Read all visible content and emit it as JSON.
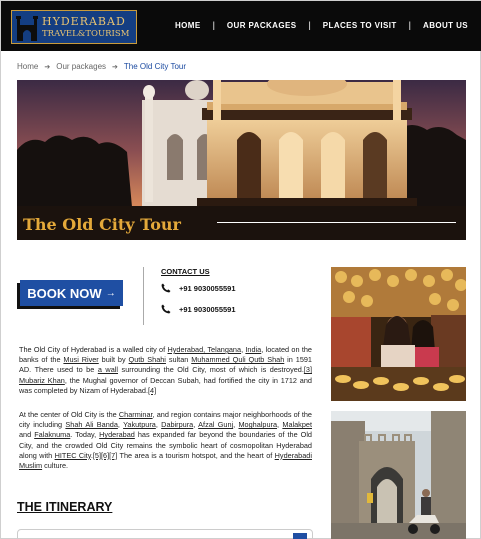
{
  "header": {
    "logo_line1": "HYDERABAD",
    "logo_line2": "TRAVEL&TOURISM",
    "nav": [
      "HOME",
      "OUR PACKAGES",
      "PLACES TO VISIT",
      "ABOUT US"
    ]
  },
  "breadcrumb": [
    "Home",
    "Our packages",
    "The Old City Tour"
  ],
  "hero": {
    "title": "The Old City Tour"
  },
  "booking": {
    "button_label": "BOOK NOW",
    "button_arrow": "→"
  },
  "contact": {
    "title": "CONTACT US",
    "phones": [
      "+91 9030055591",
      "+91 9030055591"
    ]
  },
  "paragraph1": {
    "t1": "The Old City of Hyderabad is a walled city of ",
    "l1": "Hyderabad, Telangana",
    "t2": ", ",
    "l2": "India",
    "t3": ", located on the banks of the ",
    "l3": "Musi River",
    "t4": " built by ",
    "l4": "Qutb Shahi",
    "t5": " sultan ",
    "l5": "Muhammed Quli Qutb Shah",
    "t6": " in 1591 AD. There used to be ",
    "l6": "a wall",
    "t7": " surrounding the Old City, most of which is destroyed.",
    "l7": "[3]",
    "t8": " ",
    "l8": "Mubariz Khan",
    "t9": ", the Mughal governor of Deccan Subah, had fortified the city in 1712 and was completed by Nizam of Hyderabad.",
    "l9": "[4]"
  },
  "paragraph2": {
    "t1": "At the center of Old City is the ",
    "l1": "Charminar",
    "t2": ", and region contains major neighborhoods of the city including ",
    "l2": "Shah Ali Banda",
    "t3": ", ",
    "l3": "Yakutpura",
    "t4": ", ",
    "l4": "Dabirpura",
    "t5": ", ",
    "l5": "Afzal Gunj",
    "t6": ", ",
    "l6": "Moghalpura",
    "t7": ", ",
    "l7": "Malakpet",
    "t8": " and ",
    "l8": "Falaknuma",
    "t9": ". Today, ",
    "l9": "Hyderabad",
    "t10": " has expanded far beyond the boundaries of the Old City, and the crowded Old City remains the symbolic heart of cosmopolitan Hyderabad along with ",
    "l10": "HITEC City",
    "t11": ".",
    "l11": "[5][6][7]",
    "t12": " The area is a tourism hotspot, and the heart of ",
    "l12": "Hyderabadi Muslim",
    "t13": " culture."
  },
  "itinerary": {
    "title": "THE ITINERARY"
  },
  "icons": {
    "logo": "charminar-logo-icon",
    "phone": "phone-icon",
    "breadcrumb_separator": "arrow-right-icon"
  },
  "colors": {
    "header_bg": "#0a0a0a",
    "brand_blue": "#1f4fa3",
    "logo_gold": "#e7c372",
    "hero_title_gold": "#e4a93a",
    "breadcrumb_active": "#1b4aa0"
  }
}
